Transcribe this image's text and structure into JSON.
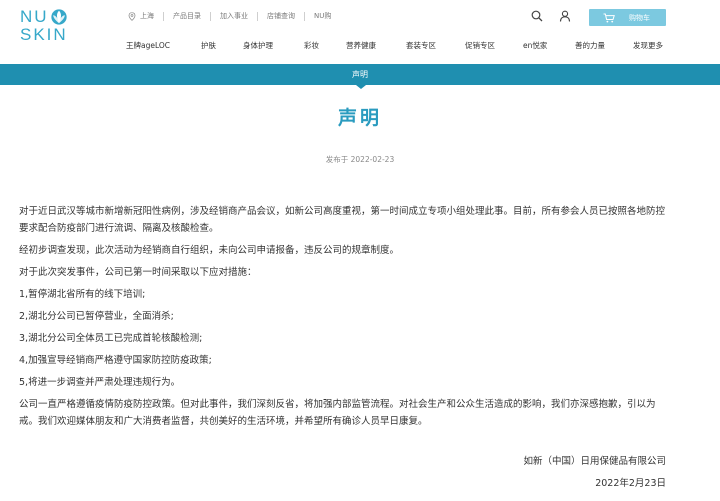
{
  "brand": {
    "logo_top": "NU",
    "logo_bottom": "SKIN"
  },
  "topnav": {
    "location": "上海",
    "items": [
      "产品目录",
      "加入事业",
      "店铺查询",
      "NU购"
    ]
  },
  "cart": {
    "label": "购物车"
  },
  "mainnav": {
    "items": [
      "王牌ageLOC",
      "护肤",
      "身体护理",
      "彩妆",
      "营养健康",
      "套装专区",
      "促销专区",
      "en悦家",
      "善的力量",
      "发现更多"
    ]
  },
  "banner": {
    "label": "声明"
  },
  "article": {
    "title": "声明",
    "date": "发布于 2022-02-23",
    "paragraphs": [
      "对于近日武汉等城市新增新冠阳性病例，涉及经销商产品会议，如新公司高度重视，第一时间成立专项小组处理此事。目前，所有参会人员已按照各地防控要求配合防疫部门进行流调、隔离及核酸检查。",
      "经初步调查发现，此次活动为经销商自行组织，未向公司申请报备，违反公司的规章制度。",
      "对于此次突发事件，公司已第一时间采取以下应对措施：",
      "1,暂停湖北省所有的线下培训;",
      "2,湖北分公司已暂停营业，全面消杀;",
      "3,湖北分公司全体员工已完成首轮核酸检测;",
      "4,加强宣导经销商严格遵守国家防控防疫政策;",
      "5,将进一步调查并严肃处理违规行为。",
      "公司一直严格遵循疫情防疫防控政策。但对此事件，我们深刻反省，将加强内部监管流程。对社会生产和公众生活造成的影响，我们亦深感抱歉，引以为戒。我们欢迎媒体朋友和广大消费者监督，共创美好的生活环境，并希望所有确诊人员早日康复。"
    ],
    "signature": "如新（中国）日用保健品有限公司",
    "signature_date": "2022年2月23日"
  },
  "colors": {
    "brand": "#36a8c9",
    "banner": "#1f8fb0",
    "title": "#2a9bbf",
    "cart_button": "#7cc9e0"
  }
}
